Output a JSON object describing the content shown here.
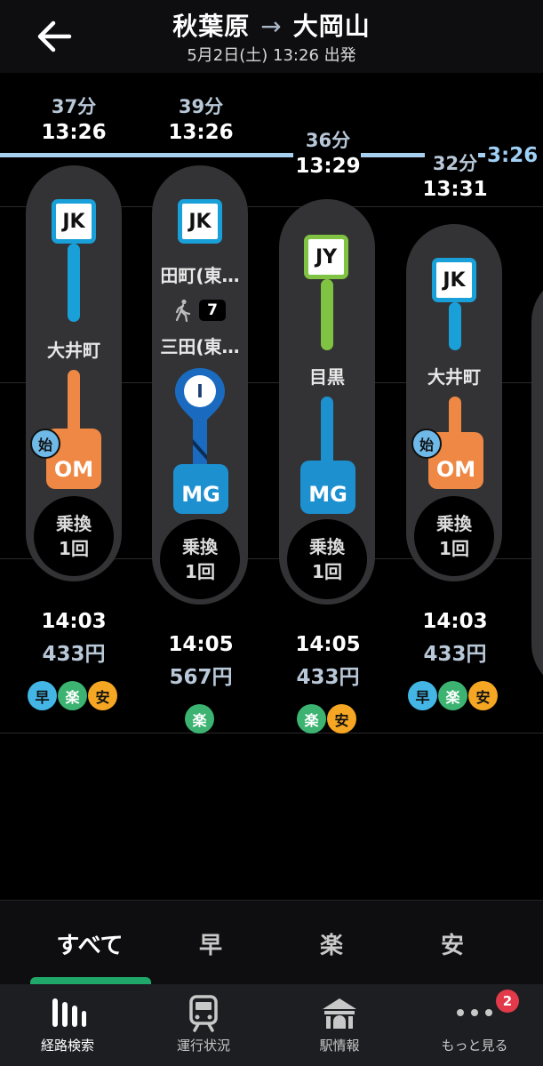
{
  "header": {
    "from": "秋葉原",
    "to": "大岡山",
    "arrow": "→",
    "subtitle": "5月2日(土) 13:26 出発"
  },
  "timeline_label": "3:26",
  "routes": [
    {
      "duration": "37分",
      "depart": "13:26",
      "line1": "JK",
      "line1_color": "#1aa0d8",
      "mid_station": "大井町",
      "start_badge": "始",
      "dest_code": "OM",
      "dest_color": "#ee8844",
      "transfer_label": "乗換",
      "transfer_count": "1回",
      "arrive": "14:03",
      "fare": "433円",
      "tags": [
        "早",
        "楽",
        "安"
      ]
    },
    {
      "duration": "39分",
      "depart": "13:26",
      "line1": "JK",
      "line1_color": "#1aa0d8",
      "station_a": "田町(東…",
      "walk_minutes": "7",
      "station_b": "三田(東…",
      "line_mid": "I",
      "line_mid_color": "#1a6bc0",
      "dest_code": "MG",
      "dest_color": "#1d90d0",
      "transfer_label": "乗換",
      "transfer_count": "1回",
      "arrive": "14:05",
      "fare": "567円",
      "tags": [
        "楽"
      ]
    },
    {
      "duration": "36分",
      "depart": "13:29",
      "line1": "JY",
      "line1_color": "#80c342",
      "mid_station": "目黒",
      "dest_code": "MG",
      "dest_color": "#1d90d0",
      "transfer_label": "乗換",
      "transfer_count": "1回",
      "arrive": "14:05",
      "fare": "433円",
      "tags": [
        "楽",
        "安"
      ]
    },
    {
      "duration": "32分",
      "depart": "13:31",
      "line1": "JK",
      "line1_color": "#1aa0d8",
      "mid_station": "大井町",
      "start_badge": "始",
      "dest_code": "OM",
      "dest_color": "#ee8844",
      "transfer_label": "乗換",
      "transfer_count": "1回",
      "arrive": "14:03",
      "fare": "433円",
      "tags": [
        "早",
        "楽",
        "安"
      ]
    }
  ],
  "tag_colors": {
    "早": "#44b6e6",
    "楽": "#3cb371",
    "安": "#f5a623"
  },
  "filter_tabs": [
    {
      "label": "すべて",
      "active": true
    },
    {
      "label": "早"
    },
    {
      "label": "楽"
    },
    {
      "label": "安"
    }
  ],
  "bottom_nav": [
    {
      "label": "経路検索",
      "icon": "route-search-icon",
      "active": true
    },
    {
      "label": "運行状況",
      "icon": "train-icon"
    },
    {
      "label": "駅情報",
      "icon": "station-icon"
    },
    {
      "label": "もっと見る",
      "icon": "more-icon",
      "badge": "2"
    }
  ]
}
